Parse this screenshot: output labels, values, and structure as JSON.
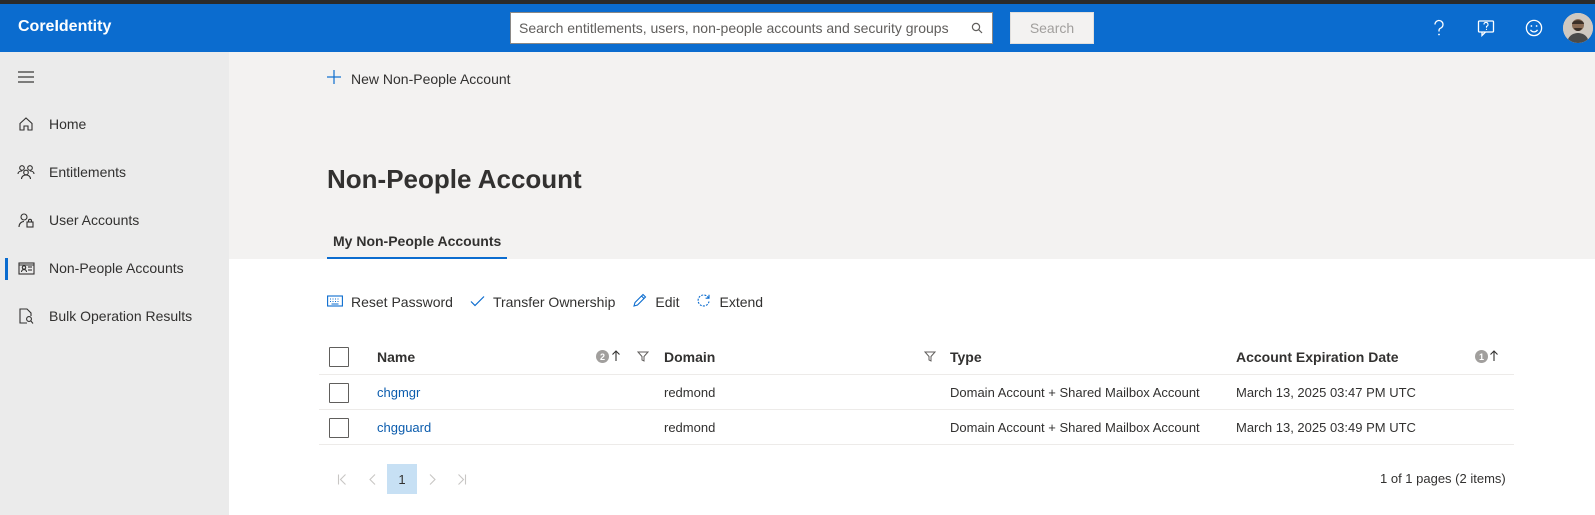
{
  "header": {
    "brand": "CoreIdentity",
    "search_placeholder": "Search entitlements, users, non-people accounts and security groups",
    "search_button": "Search",
    "icons": [
      "help-icon",
      "feedback-icon",
      "smiley-icon",
      "avatar"
    ]
  },
  "sidebar": {
    "items": [
      {
        "label": "Home",
        "icon": "home-icon"
      },
      {
        "label": "Entitlements",
        "icon": "people-icon"
      },
      {
        "label": "User Accounts",
        "icon": "user-lock-icon"
      },
      {
        "label": "Non-People Accounts",
        "icon": "contact-card-icon",
        "active": true
      },
      {
        "label": "Bulk Operation Results",
        "icon": "document-search-icon"
      }
    ]
  },
  "main": {
    "new_button": "New Non-People Account",
    "title": "Non-People Account",
    "tab": "My Non-People Accounts",
    "commands": [
      {
        "label": "Reset Password",
        "icon": "keyboard-icon"
      },
      {
        "label": "Transfer Ownership",
        "icon": "checkmark-icon"
      },
      {
        "label": "Edit",
        "icon": "edit-icon"
      },
      {
        "label": "Extend",
        "icon": "refresh-icon"
      }
    ],
    "grid": {
      "columns": [
        {
          "label": "Name",
          "sort_order": "2",
          "sort": "asc"
        },
        {
          "label": "Domain"
        },
        {
          "label": "Type"
        },
        {
          "label": "Account Expiration Date",
          "sort_order": "1",
          "sort": "asc"
        }
      ],
      "rows": [
        {
          "name": "chgmgr",
          "domain": "redmond",
          "type": "Domain Account + Shared Mailbox Account",
          "expiration": "March 13, 2025 03:47 PM UTC"
        },
        {
          "name": "chgguard",
          "domain": "redmond",
          "type": "Domain Account + Shared Mailbox Account",
          "expiration": "March 13, 2025 03:49 PM UTC"
        }
      ]
    },
    "pager": {
      "current_page": "1",
      "info": "1 of 1 pages (2 items)"
    }
  },
  "colors": {
    "accent": "#0b6ccf",
    "link": "#0b5cad",
    "sidebar_bg": "#ebebeb",
    "header_band_bg": "#f3f2f1"
  }
}
